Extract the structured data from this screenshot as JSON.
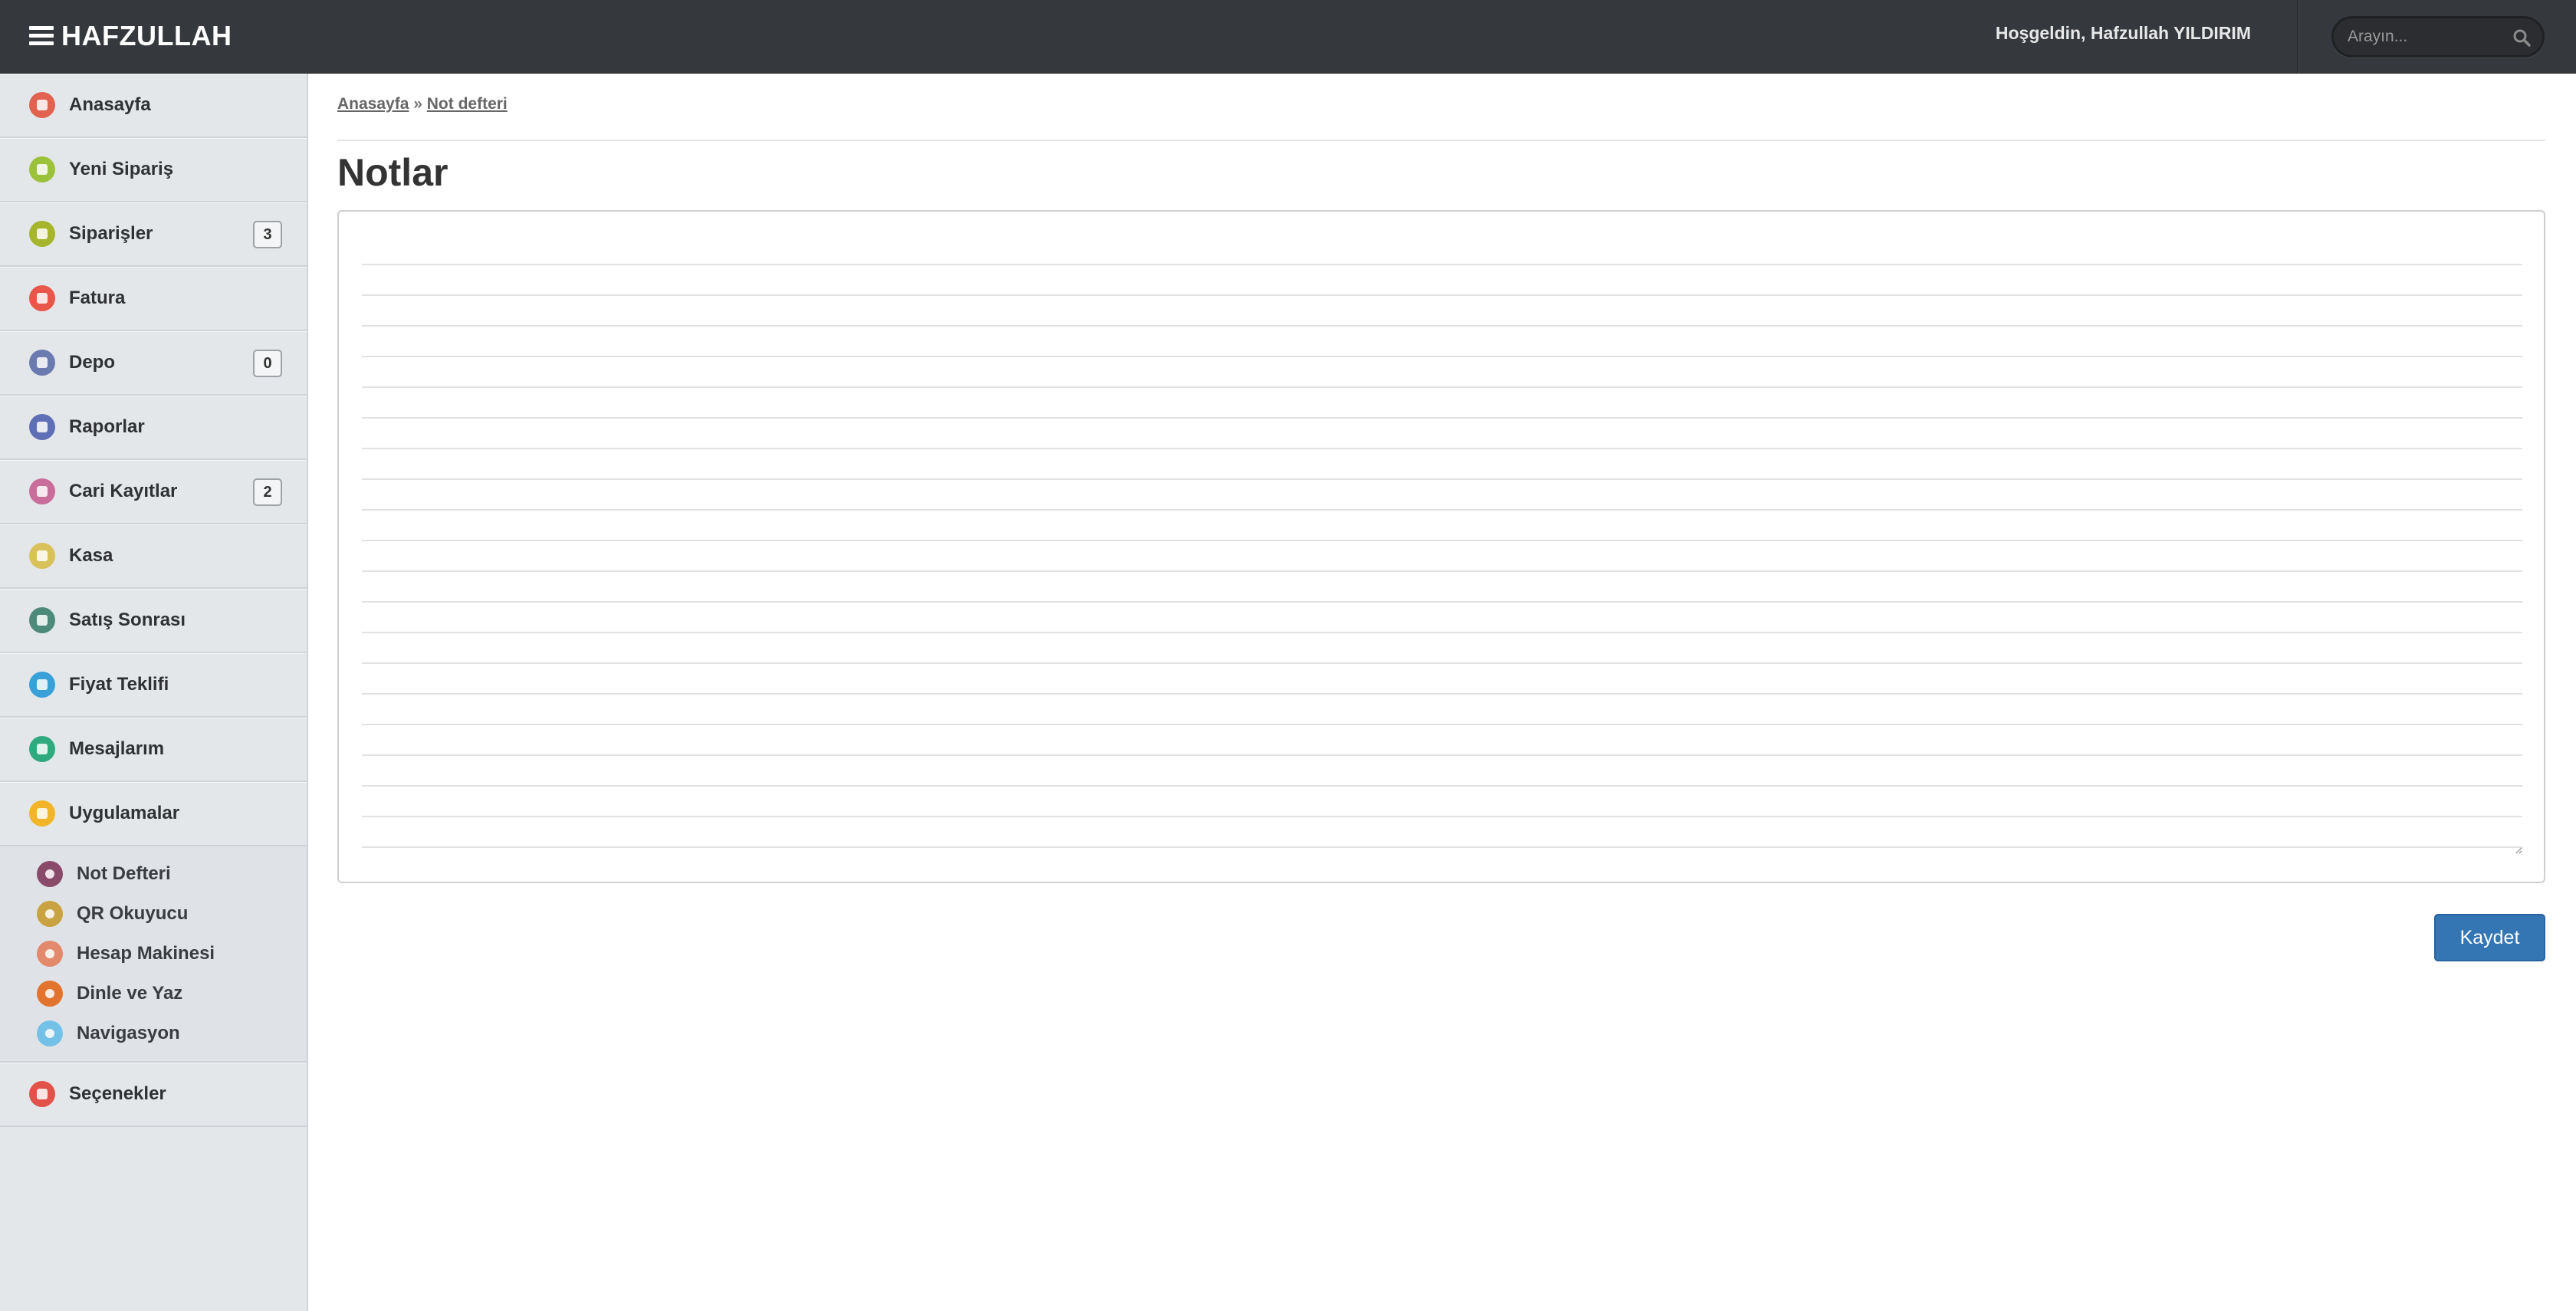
{
  "app": {
    "brand": "HAFZULLAH",
    "welcome": "Hoşgeldin, Hafzullah YILDIRIM",
    "search_placeholder": "Arayın..."
  },
  "sidebar": {
    "items": [
      {
        "label": "Anasayfa",
        "icon": "home-icon",
        "color": "#e0624f"
      },
      {
        "label": "Yeni Sipariş",
        "icon": "new-order-icon",
        "color": "#9cc23b"
      },
      {
        "label": "Siparişler",
        "icon": "orders-icon",
        "color": "#a5b52c",
        "badge": "3"
      },
      {
        "label": "Fatura",
        "icon": "invoice-icon",
        "color": "#e8574a"
      },
      {
        "label": "Depo",
        "icon": "warehouse-icon",
        "color": "#6b7bb0",
        "badge": "0"
      },
      {
        "label": "Raporlar",
        "icon": "reports-icon",
        "color": "#5f6fb5"
      },
      {
        "label": "Cari Kayıtlar",
        "icon": "accounts-icon",
        "color": "#c96d9a",
        "badge": "2"
      },
      {
        "label": "Kasa",
        "icon": "cash-icon",
        "color": "#d9c25a"
      },
      {
        "label": "Satış Sonrası",
        "icon": "after-sales-icon",
        "color": "#4e8a7a"
      },
      {
        "label": "Fiyat Teklifi",
        "icon": "quote-icon",
        "color": "#3aa1d8"
      },
      {
        "label": "Mesajlarım",
        "icon": "messages-icon",
        "color": "#2eaa7e"
      },
      {
        "label": "Uygulamalar",
        "icon": "apps-icon",
        "color": "#f2b52a"
      }
    ],
    "subitems": [
      {
        "label": "Not Defteri",
        "icon": "notepad-icon",
        "color": "#8a4a6a"
      },
      {
        "label": "QR Okuyucu",
        "icon": "qr-reader-icon",
        "color": "#c9a341"
      },
      {
        "label": "Hesap Makinesi",
        "icon": "calculator-icon",
        "color": "#e48a6c"
      },
      {
        "label": "Dinle ve Yaz",
        "icon": "microphone-icon",
        "color": "#e2742f"
      },
      {
        "label": "Navigasyon",
        "icon": "navigation-icon",
        "color": "#74c1e8"
      }
    ],
    "options": {
      "label": "Seçenekler",
      "icon": "options-icon",
      "color": "#e0524a"
    }
  },
  "breadcrumb": {
    "home": "Anasayfa",
    "separator": "»",
    "current": "Not defteri"
  },
  "main": {
    "title": "Notlar",
    "note_value": "",
    "save_label": "Kaydet"
  }
}
